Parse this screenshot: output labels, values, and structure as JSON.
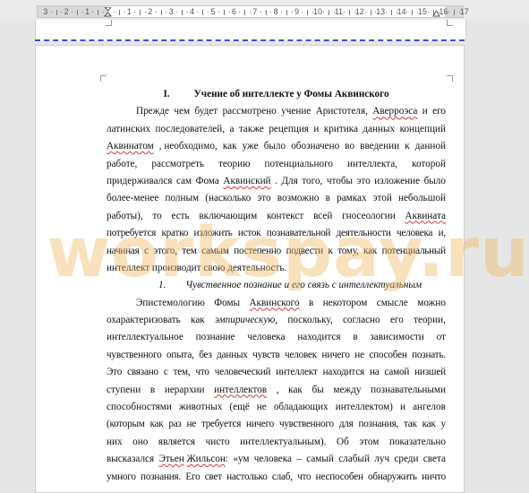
{
  "ruler": {
    "numbers": [
      "3",
      "2",
      "1",
      "1",
      "2",
      "3",
      "4",
      "5",
      "6",
      "7",
      "8",
      "9",
      "10",
      "11",
      "12",
      "13",
      "14",
      "15",
      "16",
      "17"
    ]
  },
  "document": {
    "heading_number": "I.",
    "heading_title": "Учение об интеллекте у Фомы Аквинского",
    "subheading_number": "1.",
    "subheading_title": "Чувственное познание и его связь с интеллектуальным",
    "para1": [
      "Прежде чем будет рассмотрено учение Аристотеля, Аверроэса и его",
      "латинских последователей, а также рецепция и критика данных концепций",
      "Аквинатом, необходимо, как уже было обозначено во введении к данной",
      "работе, рассмотреть теорию потенциального интеллекта, которой",
      "придерживался сам Фома Аквинский. Для того, чтобы это изложение было",
      "более-менее полным (насколько это возможно в рамках этой небольшой",
      "работы), то есть включающим контекст всей гносеологии Аквината,",
      "потребуется кратко изложить исток познавательной деятельности человека и,",
      "начиная с этого, тем самым постепенно подвести к тому, как потенциальный",
      "интеллект производит свою деятельность."
    ],
    "para2": [
      "Эпистемологию Фомы Аквинского в некотором смысле можно",
      "охарактеризовать как эмпирическую, поскольку, согласно его теории,",
      "интеллектуальное познание человека находится в зависимости от",
      "чувственного опыта, без данных чувств человек ничего не способен познать.",
      "Это связано с тем, что человеческий интеллект находится на самой низшей",
      "ступени в иерархии интеллектов, как бы между познавательными",
      "способностями животных (ещё не обладающих интеллектом) и ангелов",
      "(которым как раз не требуется ничего чувственного для познания, так как у",
      "них оно является чисто интеллектуальным). Об этом показательно",
      "высказался Этьен Жильсон: «ум человека – самый слабый луч среди света",
      "умного познания. Его свет настолько слаб, что неспособен обнаружить ничто"
    ]
  },
  "watermark": "workspay.ru",
  "colors": {
    "page_break": "#3d4fd6",
    "spell_underline": "#d23a3a",
    "watermark": "#eeb762"
  }
}
